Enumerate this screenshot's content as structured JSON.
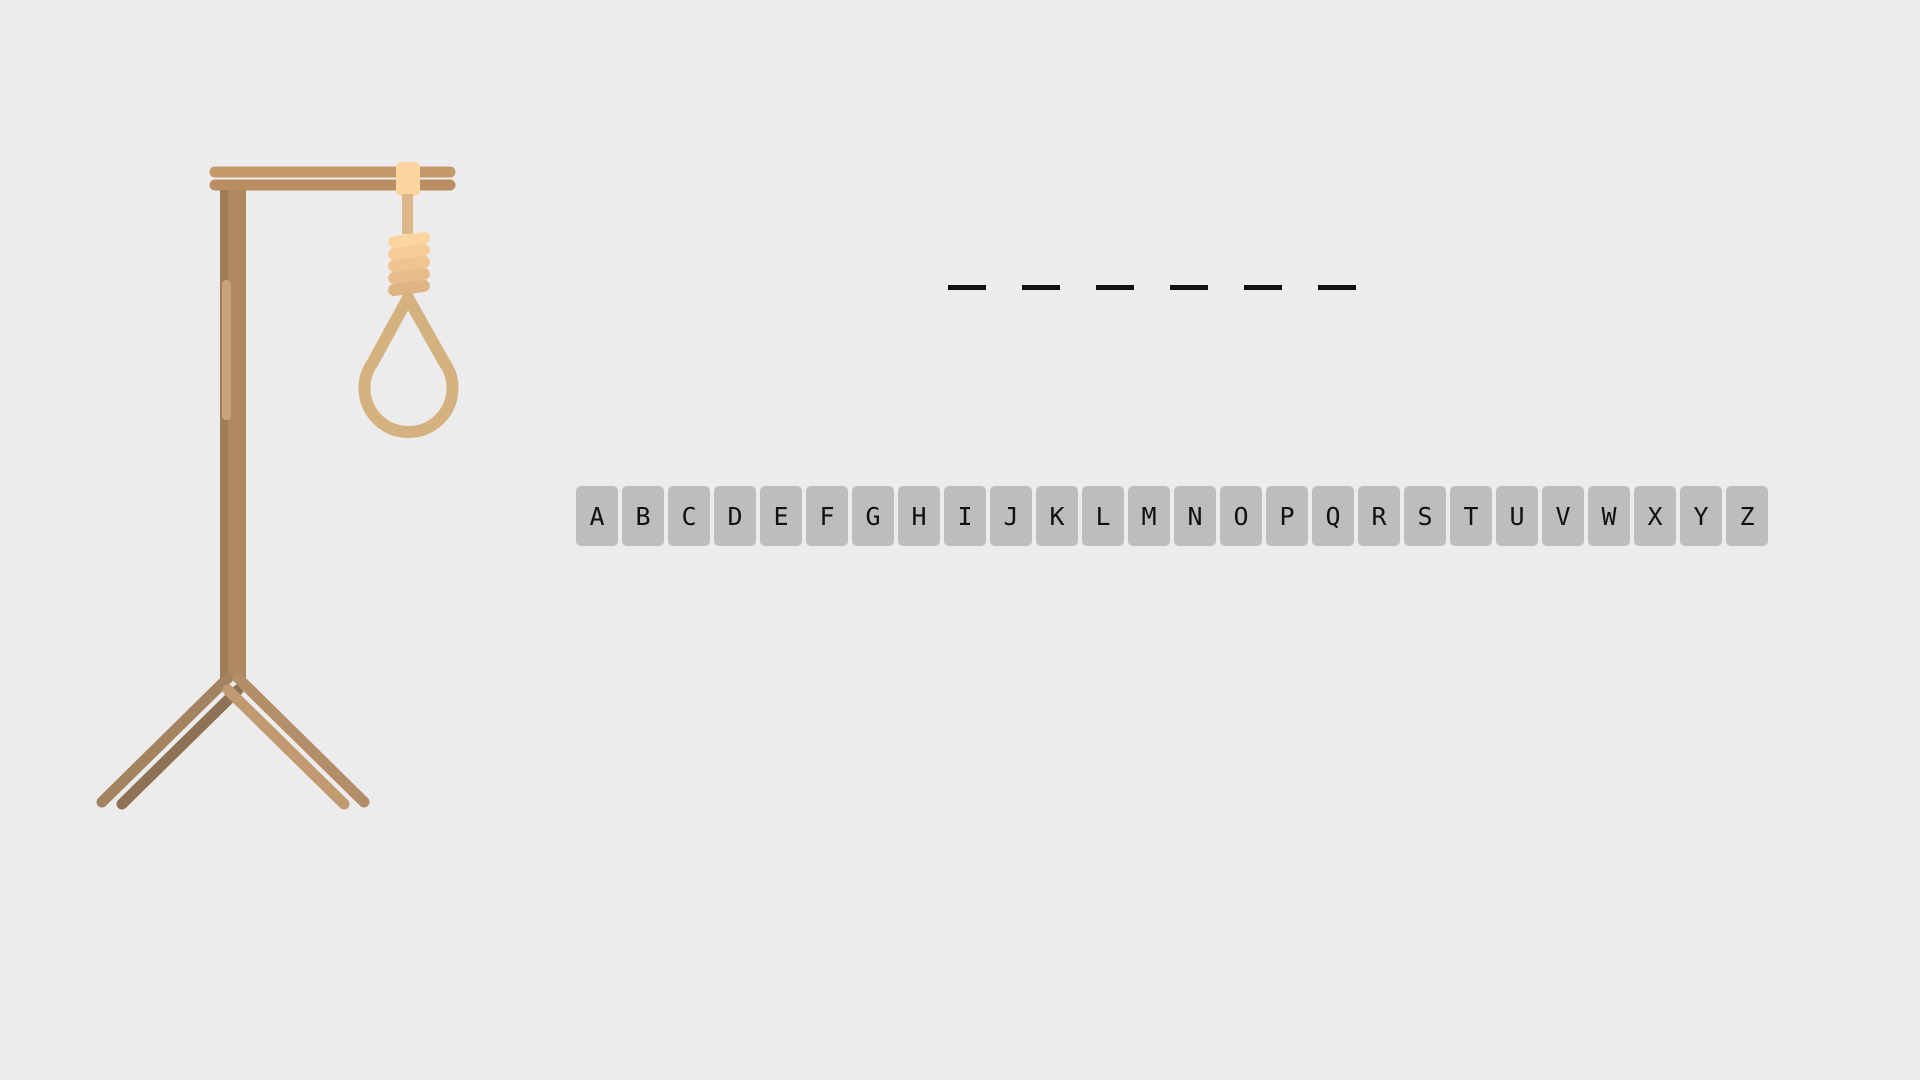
{
  "game": {
    "word_blanks": [
      "",
      "",
      "",
      "",
      "",
      ""
    ],
    "keyboard": [
      "A",
      "B",
      "C",
      "D",
      "E",
      "F",
      "G",
      "H",
      "I",
      "J",
      "K",
      "L",
      "M",
      "N",
      "O",
      "P",
      "Q",
      "R",
      "S",
      "T",
      "U",
      "V",
      "W",
      "X",
      "Y",
      "Z"
    ]
  },
  "gallows_icon": "gallows-with-noose",
  "colors": {
    "background": "#ececec",
    "key_background": "#bdbdbd",
    "wood": "#c4996a",
    "wood_dark": "#9c7a57",
    "rope": "#d7b283",
    "rope_light": "#fbd4a0"
  }
}
